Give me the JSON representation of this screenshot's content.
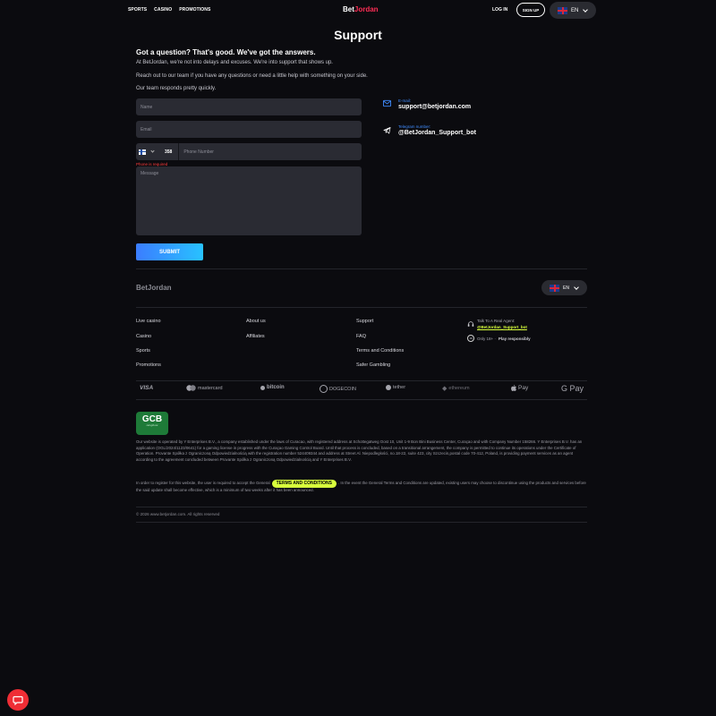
{
  "header": {
    "nav": [
      "SPORTS",
      "CASINO",
      "PROMOTIONS"
    ],
    "logo_main": "Bet",
    "logo_accent": "Jordan",
    "login": "LOG IN",
    "signup": "SIGN UP",
    "lang": "EN"
  },
  "support": {
    "title": "Support",
    "headline": "Got a question?  That's good. We've got the answers.",
    "p1": "At BetJordan, we're not into delays and excuses. We're into support that shows up.",
    "p2": "Reach out to our team if you have any questions or need a little help with something on your side.",
    "p3": "Our team responds pretty quickly.",
    "form": {
      "name_placeholder": "Name",
      "email_placeholder": "Email",
      "country_code": "358",
      "phone_placeholder": "Phone Number",
      "phone_error": "Phone is required",
      "message_placeholder": "Message",
      "submit": "SUBMIT"
    },
    "contacts": {
      "email_label": "E-mail:",
      "email_value": "support@betjordan.com",
      "telegram_label": "Telegram number:",
      "telegram_value": "@BetJordan_Support_bot"
    }
  },
  "footer": {
    "logo": "BetJordan",
    "lang": "EN",
    "col1": [
      "Live casino",
      "Casino",
      "Sports",
      "Promotions"
    ],
    "col2": [
      "About us",
      "Affiliates"
    ],
    "col3": [
      "Support",
      "FAQ",
      "Terms and Conditions",
      "Safer Gambling"
    ],
    "agent_label": "Talk To A Real Agent:",
    "agent_handle": "@BetJordan_Support_bot",
    "age_badge": "18",
    "age_text": "Only 18+ ·",
    "age_resp": "Play responsibly",
    "payments": [
      "VISA",
      "mastercard",
      "bitcoin",
      "DOGECOIN",
      "tether",
      "ethereum",
      "Pay",
      "G Pay"
    ],
    "gcb_title": "GCB",
    "gcb_sub": "cert.gcb.cw",
    "legal1": "Our website is operated by Y Enterprises B.V., a company established under the laws of Curacao, with registered address at Schottegatweg Oost 10, Unit 1-9 Bon Bini Business Center, Curaçao and with Company Number 158266. Y Enterprises B.V. has an application (OGL/2024/1123/0641) for a gaming license in progress with the Curaçao Gaming Control Board. Until that process is concluded, based on a transitional arrangement, the company is permitted to continue its operations under the Certificate of Operation. Provante Spółka z Ograniczoną Odpowiedzialnością with the registration number 524409344 and address at Street Al. Niepodległości, no.18-22, suite 423, city Szczecin,postal code 70-412, Poland, is providing payment services as an agent according to the agreement concluded between Provante Spółka z Ograniczoną Odpowiedzialnością and Y Enterprises B.V.",
    "legal2_a": "In order to register for this website, the user is required to accept the General",
    "legal2_btn": "TERMS AND CONDITIONS",
    "legal2_b": ". In the event the General Terms and Conditions are updated, existing users may choose to discontinue using the products and services before the said update shall become effective, which is a minimum of two weeks after it has been announced.",
    "copyright": "© 2026 www.betjordan.com. All rights reserved"
  }
}
